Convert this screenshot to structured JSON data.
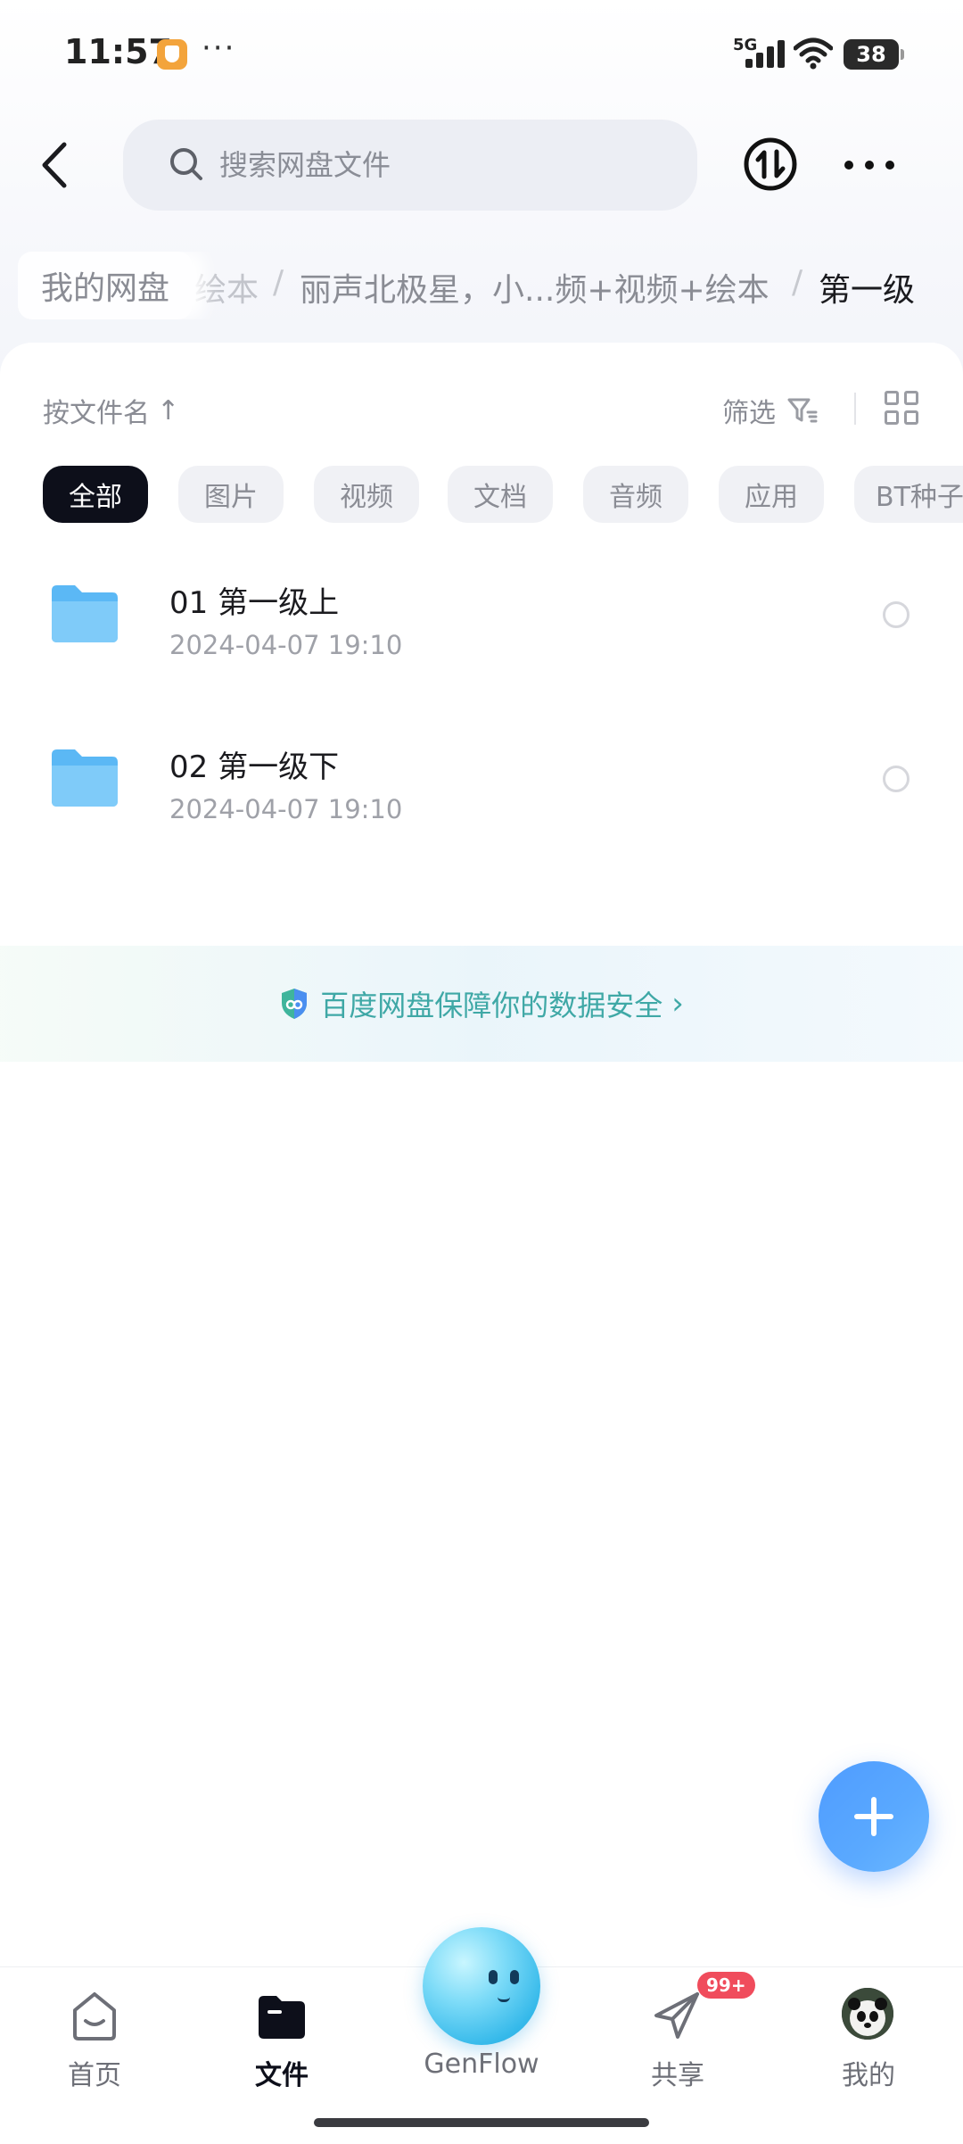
{
  "status_bar": {
    "time": "11:57",
    "dots": "···",
    "network": "5G",
    "battery": "38"
  },
  "header": {
    "search_placeholder": "搜索网盘文件"
  },
  "breadcrumb": {
    "root": "我的网盘",
    "faded": "绘本",
    "separator": "/",
    "middle": "丽声北极星，小...频+视频+绘本",
    "current": "第一级"
  },
  "toolbar": {
    "sort_label": "按文件名",
    "sort_arrow": "↑",
    "filter_label": "筛选"
  },
  "categories": [
    {
      "label": "全部",
      "active": true
    },
    {
      "label": "图片",
      "active": false
    },
    {
      "label": "视频",
      "active": false
    },
    {
      "label": "文档",
      "active": false
    },
    {
      "label": "音频",
      "active": false
    },
    {
      "label": "应用",
      "active": false
    },
    {
      "label": "BT种子",
      "active": false
    }
  ],
  "files": [
    {
      "name": "01 第一级上",
      "date": "2024-04-07  19:10",
      "type": "folder"
    },
    {
      "name": "02 第一级下",
      "date": "2024-04-07  19:10",
      "type": "folder"
    }
  ],
  "security_banner": {
    "text": "百度网盘保障你的数据安全",
    "chevron": "›"
  },
  "bottom_nav": {
    "items": [
      {
        "label": "首页",
        "icon": "home-icon",
        "active": false
      },
      {
        "label": "文件",
        "icon": "folder-icon",
        "active": true
      },
      {
        "label": "GenFlow",
        "icon": "genflow-orb",
        "active": false
      },
      {
        "label": "共享",
        "icon": "paper-plane-icon",
        "active": false
      },
      {
        "label": "我的",
        "icon": "avatar",
        "active": false
      }
    ],
    "share_badge": "99+"
  },
  "colors": {
    "accent": "#4f9cff",
    "chip_active_bg": "#0d0f1a",
    "security_text": "#3fa8a6",
    "folder": "#5bb8f5",
    "badge": "#f04c5c"
  }
}
